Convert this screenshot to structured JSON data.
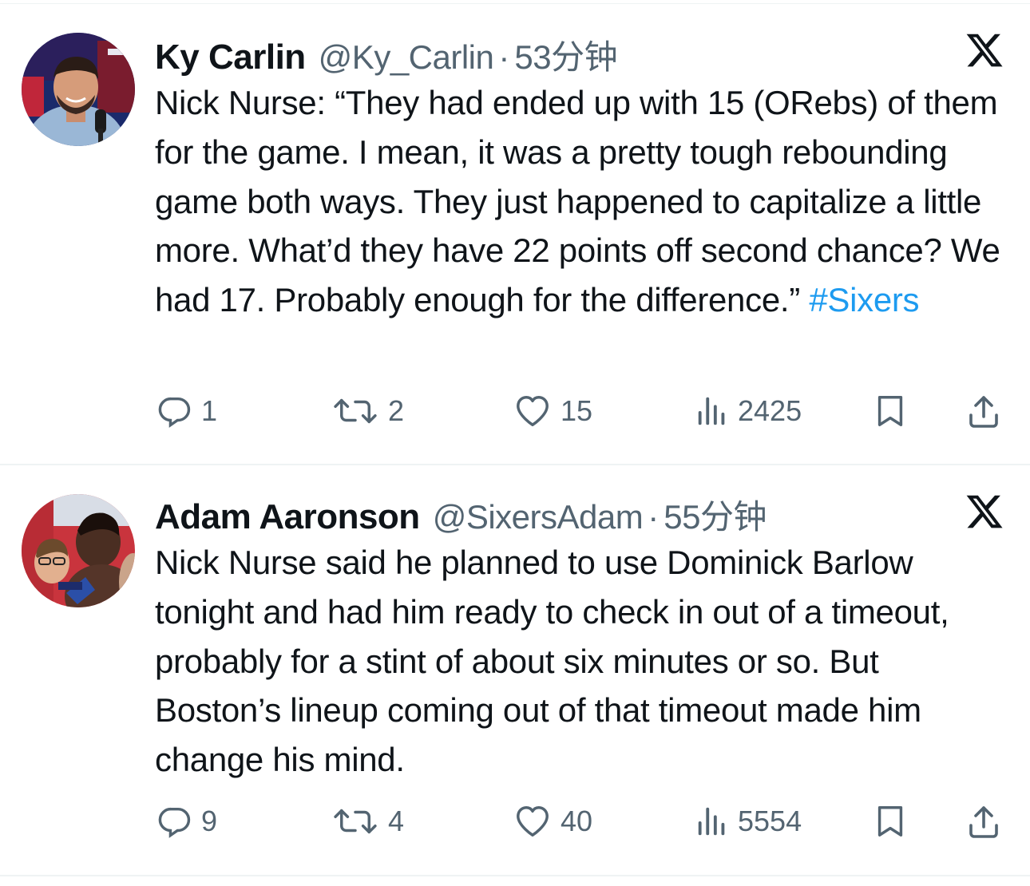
{
  "tweets": [
    {
      "name": "Ky Carlin",
      "handle": "@Ky_Carlin",
      "separator": "·",
      "time": "53分钟",
      "text": "Nick Nurse: “They had ended up with 15 (ORebs) of them for the game. I mean, it was a pretty tough rebounding game both ways. They just happened to capitalize a little more. What’d they have 22 points off second chance? We had 17. Probably enough for the difference.”",
      "hashtag": "#Sixers",
      "replies": "1",
      "retweets": "2",
      "likes": "15",
      "views": "2425"
    },
    {
      "name": "Adam Aaronson",
      "handle": "@SixersAdam",
      "separator": "·",
      "time": "55分钟",
      "text": "Nick Nurse said he planned to use Dominick Barlow tonight and had him ready to check in out of a timeout, probably for a stint of about six minutes or so. But Boston’s lineup coming out of that timeout made him change his mind.",
      "replies": "9",
      "retweets": "4",
      "likes": "40",
      "views": "5554"
    }
  ],
  "icons": {
    "reply": "reply-icon",
    "retweet": "retweet-icon",
    "like": "heart-icon",
    "views": "views-icon",
    "bookmark": "bookmark-icon",
    "share": "share-icon",
    "platform": "x-logo-icon"
  },
  "colors": {
    "text": "#0f1419",
    "secondary": "#536471",
    "link": "#1d9bf0",
    "divider": "#eff3f4"
  }
}
